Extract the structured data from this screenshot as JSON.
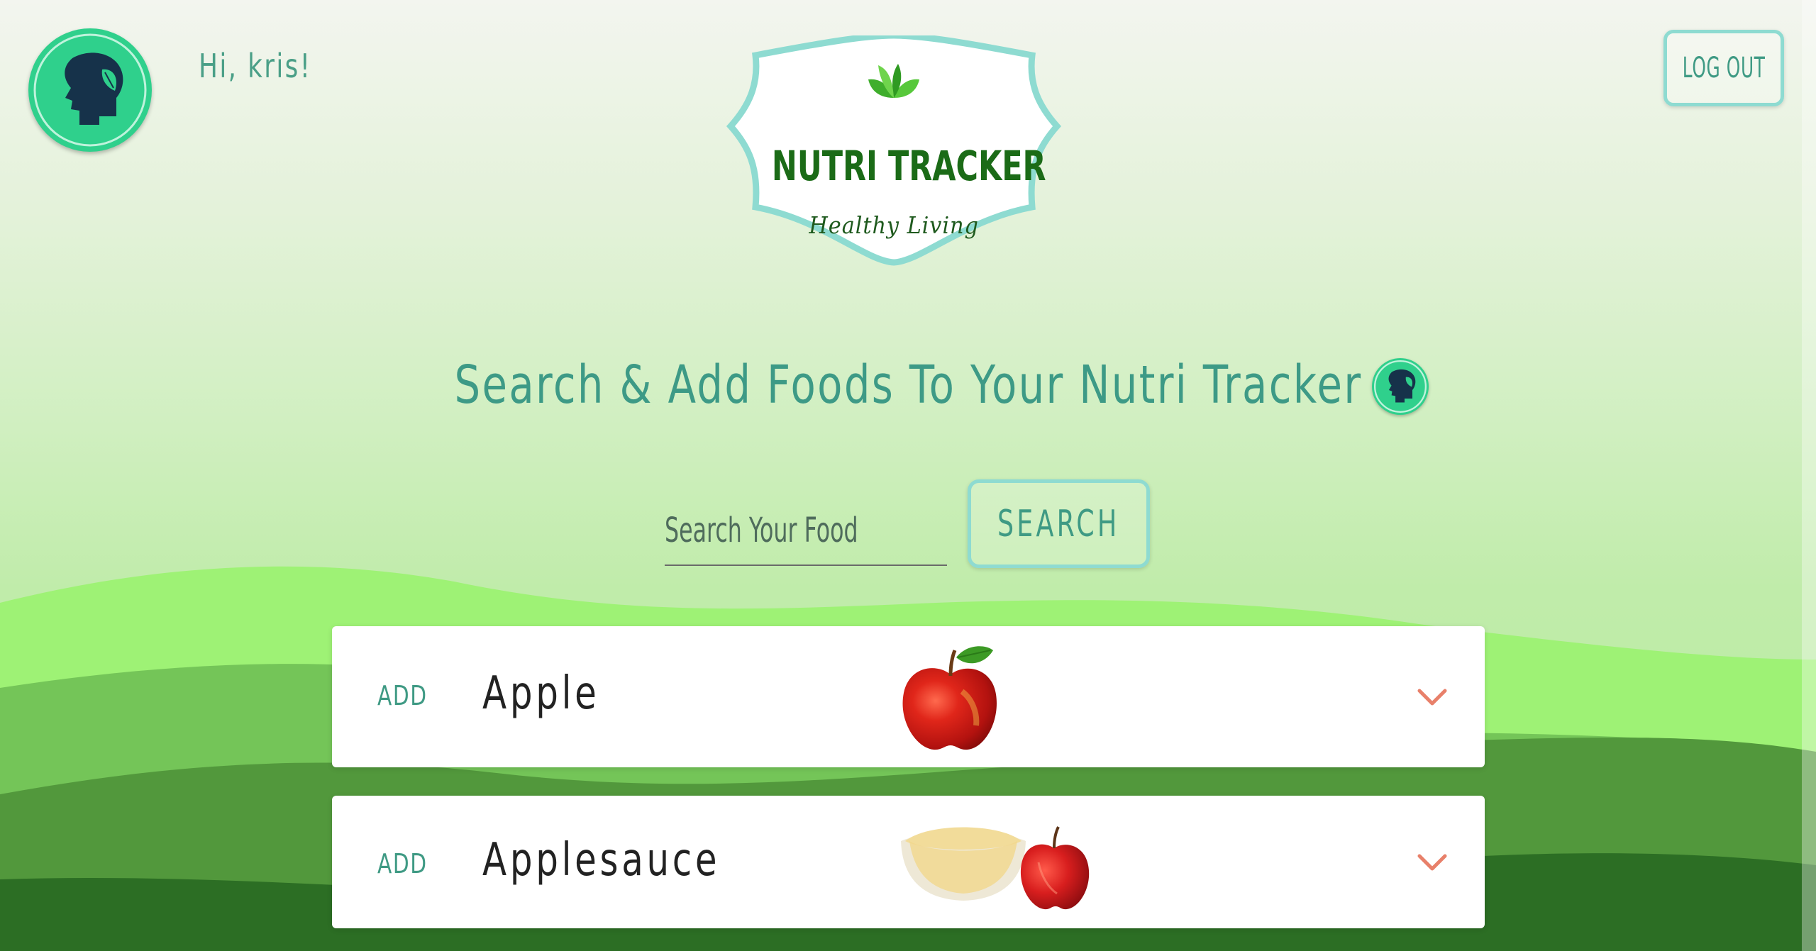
{
  "header": {
    "greeting": "Hi, kris!",
    "logout_label": "LOG OUT",
    "avatar_icon": "head-leaf-icon"
  },
  "logo": {
    "title": "NUTRI TRACKER",
    "subtitle": "Healthy Living",
    "icon": "leaf-sprout-icon"
  },
  "main": {
    "heading": "Search & Add Foods To Your Nutri Tracker",
    "search": {
      "placeholder": "Search Your Food",
      "value": "",
      "button_label": "SEARCH"
    },
    "results": [
      {
        "action_label": "ADD",
        "name": "Apple",
        "image": "apple-image",
        "expand_icon": "chevron-down-icon"
      },
      {
        "action_label": "ADD",
        "name": "Applesauce",
        "image": "applesauce-image",
        "expand_icon": "chevron-down-icon"
      }
    ]
  },
  "colors": {
    "accent": "#3f9a84",
    "brand_green": "#2fd08c",
    "button_border": "#8edbd1",
    "chevron": "#e8806a",
    "logo_title": "#1b6b17"
  }
}
